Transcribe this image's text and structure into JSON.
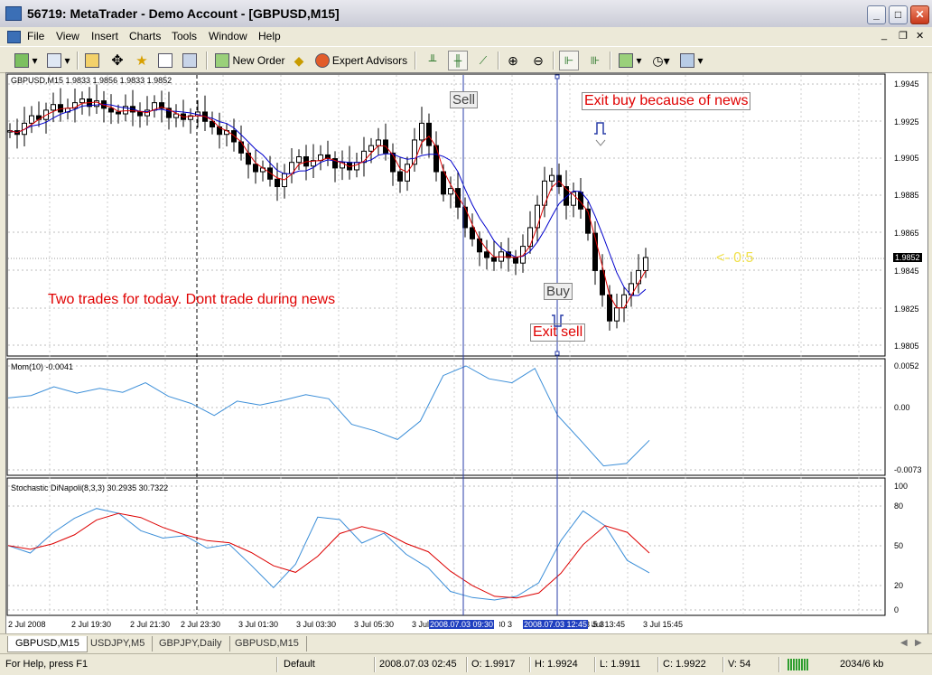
{
  "window": {
    "title": "56719: MetaTrader - Demo Account - [GBPUSD,M15]",
    "min": "_",
    "max": "□",
    "close": "✕"
  },
  "menu": [
    "File",
    "View",
    "Insert",
    "Charts",
    "Tools",
    "Window",
    "Help"
  ],
  "toolbar": {
    "new_order": "New Order",
    "expert_advisors": "Expert Advisors"
  },
  "chart": {
    "main_label": "GBPUSD,M15  1.9833  1.9856  1.9833  1.9852",
    "mom_label": "Mom(10) -0.0041",
    "stoch_label": "Stochastic DiNapoli(8,3,3) 30.2935 30.7322",
    "price_ticks": [
      "1.9945",
      "1.9925",
      "1.9905",
      "1.9885",
      "1.9865",
      "1.9845",
      "1.9825",
      "1.9805"
    ],
    "current_price": "1.9852",
    "mom_ticks": [
      "0.0052",
      "0.00",
      "-0.0073"
    ],
    "stoch_ticks": [
      "100",
      "80",
      "50",
      "20",
      "0"
    ],
    "time_ticks": [
      "2 Jul 2008",
      "2 Jul 19:30",
      "2 Jul 21:30",
      "2 Jul 23:30",
      "3 Jul 01:30",
      "3 Jul 03:30",
      "3 Jul 05:30",
      "3 Jul 07:30",
      "3 Jul 09:30",
      "3 Jul 11:45",
      "3 Jul 13:45",
      "3 Jul 15:45"
    ],
    "highlight_times": [
      "2008.07.03 09:30",
      "2008.07.03 12:45"
    ],
    "annotations": {
      "sell": "Sell",
      "buy": "Buy",
      "exit_buy": "Exit buy because of news",
      "exit_sell": "Exit sell",
      "note": "Two trades for today. Dont trade during news",
      "countdown": "<- 0:5"
    },
    "colors": {
      "note_red": "#e00000",
      "ma_blue": "#0000cc",
      "ma_red": "#dd0000",
      "mom_line": "#3b8ed8",
      "stoch_k": "#3b8ed8",
      "stoch_d": "#dd0000",
      "vline": "#2a3ea8"
    }
  },
  "chart_data": {
    "type": "line",
    "title": "GBPUSD,M15",
    "series": [
      {
        "name": "Mom(10)",
        "values": [
          0.0012,
          0.0015,
          0.0026,
          0.0018,
          0.0024,
          0.0019,
          0.0031,
          0.0014,
          0.0005,
          -0.001,
          0.0008,
          0.0003,
          0.0009,
          0.0016,
          0.0011,
          -0.0021,
          -0.0029,
          -0.004,
          -0.0017,
          0.004,
          0.0052,
          0.0036,
          0.0031,
          0.0049,
          -0.001,
          -0.0041,
          -0.0073,
          -0.007,
          -0.0041
        ]
      },
      {
        "name": "Stochastic DiNapoli(8,3,3)",
        "values": [
          52,
          46,
          62,
          74,
          82,
          78,
          64,
          58,
          60,
          50,
          53,
          36,
          18,
          37,
          75,
          73,
          54,
          62,
          45,
          34,
          15,
          10,
          8,
          11,
          22,
          56,
          80,
          68,
          40,
          30
        ]
      }
    ],
    "ylim": [
      1.9795,
      1.9955
    ]
  },
  "tabs": [
    "GBPUSD,M15",
    "USDJPY,M5",
    "GBPJPY,Daily",
    "GBPUSD,M15"
  ],
  "status": {
    "help": "For Help, press F1",
    "profile": "Default",
    "datetime": "2008.07.03 02:45",
    "open": "O: 1.9917",
    "high": "H: 1.9924",
    "low": "L: 1.9911",
    "close": "C: 1.9922",
    "volume": "V: 54",
    "traffic": "2034/6 kb"
  }
}
